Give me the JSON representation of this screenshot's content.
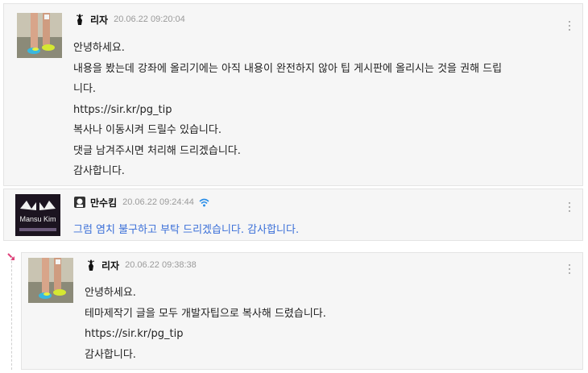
{
  "comments": [
    {
      "nickname": "리자",
      "date": "20.06.22 09:20:04",
      "lines": [
        "안녕하세요.",
        "내용을 봤는데 강좌에 올리기에는 아직 내용이 완전하지 않아 팁 게시판에 올리시는 것을 권해 드립",
        "니다.",
        "https://sir.kr/pg_tip",
        "복사나 이동시켜 드릴수 있습니다.",
        "댓글 남겨주시면 처리해 드리겠습니다.",
        "감사합니다."
      ]
    },
    {
      "nickname": "만수킴",
      "date": "20.06.22 09:24:44",
      "avatar_text": "Mansu Kim",
      "lines": [
        "그럼 염치 불구하고 부탁 드리겠습니다. 감사합니다."
      ],
      "text_color": "#3a6fd8"
    },
    {
      "nickname": "리자",
      "date": "20.06.22 09:38:38",
      "is_reply": true,
      "lines": [
        "안녕하세요.",
        "테마제작기 글을 모두 개발자팁으로 복사해 드렸습니다.",
        "https://sir.kr/pg_tip",
        "감사합니다."
      ]
    }
  ],
  "colors": {
    "reply_arrow": "#e0407a",
    "online_icon": "#2a8ee8",
    "blue_text": "#3a6fd8"
  },
  "icons": [
    "level-icon",
    "wifi-icon",
    "more-options-icon",
    "reply-arrow-icon"
  ]
}
